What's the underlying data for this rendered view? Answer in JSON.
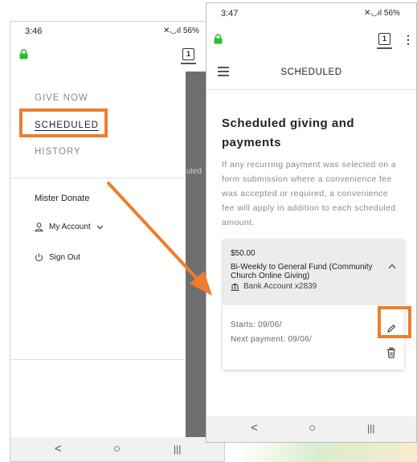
{
  "left_phone": {
    "status": {
      "time": "3:46",
      "battery": "56%"
    },
    "tab_count": "1",
    "menu": {
      "give_now": "GIVE NOW",
      "scheduled": "SCHEDULED",
      "history": "HISTORY"
    },
    "overlay_fragment": "uled",
    "user_name": "Mister Donate",
    "my_account": "My Account",
    "sign_out": "Sign Out"
  },
  "right_phone": {
    "status": {
      "time": "3:47",
      "battery": "56%"
    },
    "tab_count": "1",
    "header_title": "SCHEDULED",
    "page_title": "Scheduled giving and payments",
    "description": "If any recurring payment was selected on a form submission where a convenience fee was accepted or required, a convenience fee will apply in addition to each scheduled amount.",
    "card": {
      "amount": "$50.00",
      "description": "Bi-Weekly to General Fund (Community Church Online Giving)",
      "bank": "Bank Account x2839",
      "starts": "Starts: 09/06/",
      "next_payment": "Next payment: 09/06/"
    }
  },
  "nav": {
    "back": "<",
    "home": "○",
    "recents": "|||"
  },
  "colors": {
    "highlight": "#ee7d2d",
    "lock": "#2bbd2b",
    "overlay": "#6e6e6e"
  },
  "icons": [
    "lock-icon",
    "tab-switcher-icon",
    "user-icon",
    "chevron-down-icon",
    "power-icon",
    "hamburger-icon",
    "kebab-menu-icon",
    "chevron-up-icon",
    "bank-icon",
    "pencil-icon",
    "trash-icon"
  ]
}
